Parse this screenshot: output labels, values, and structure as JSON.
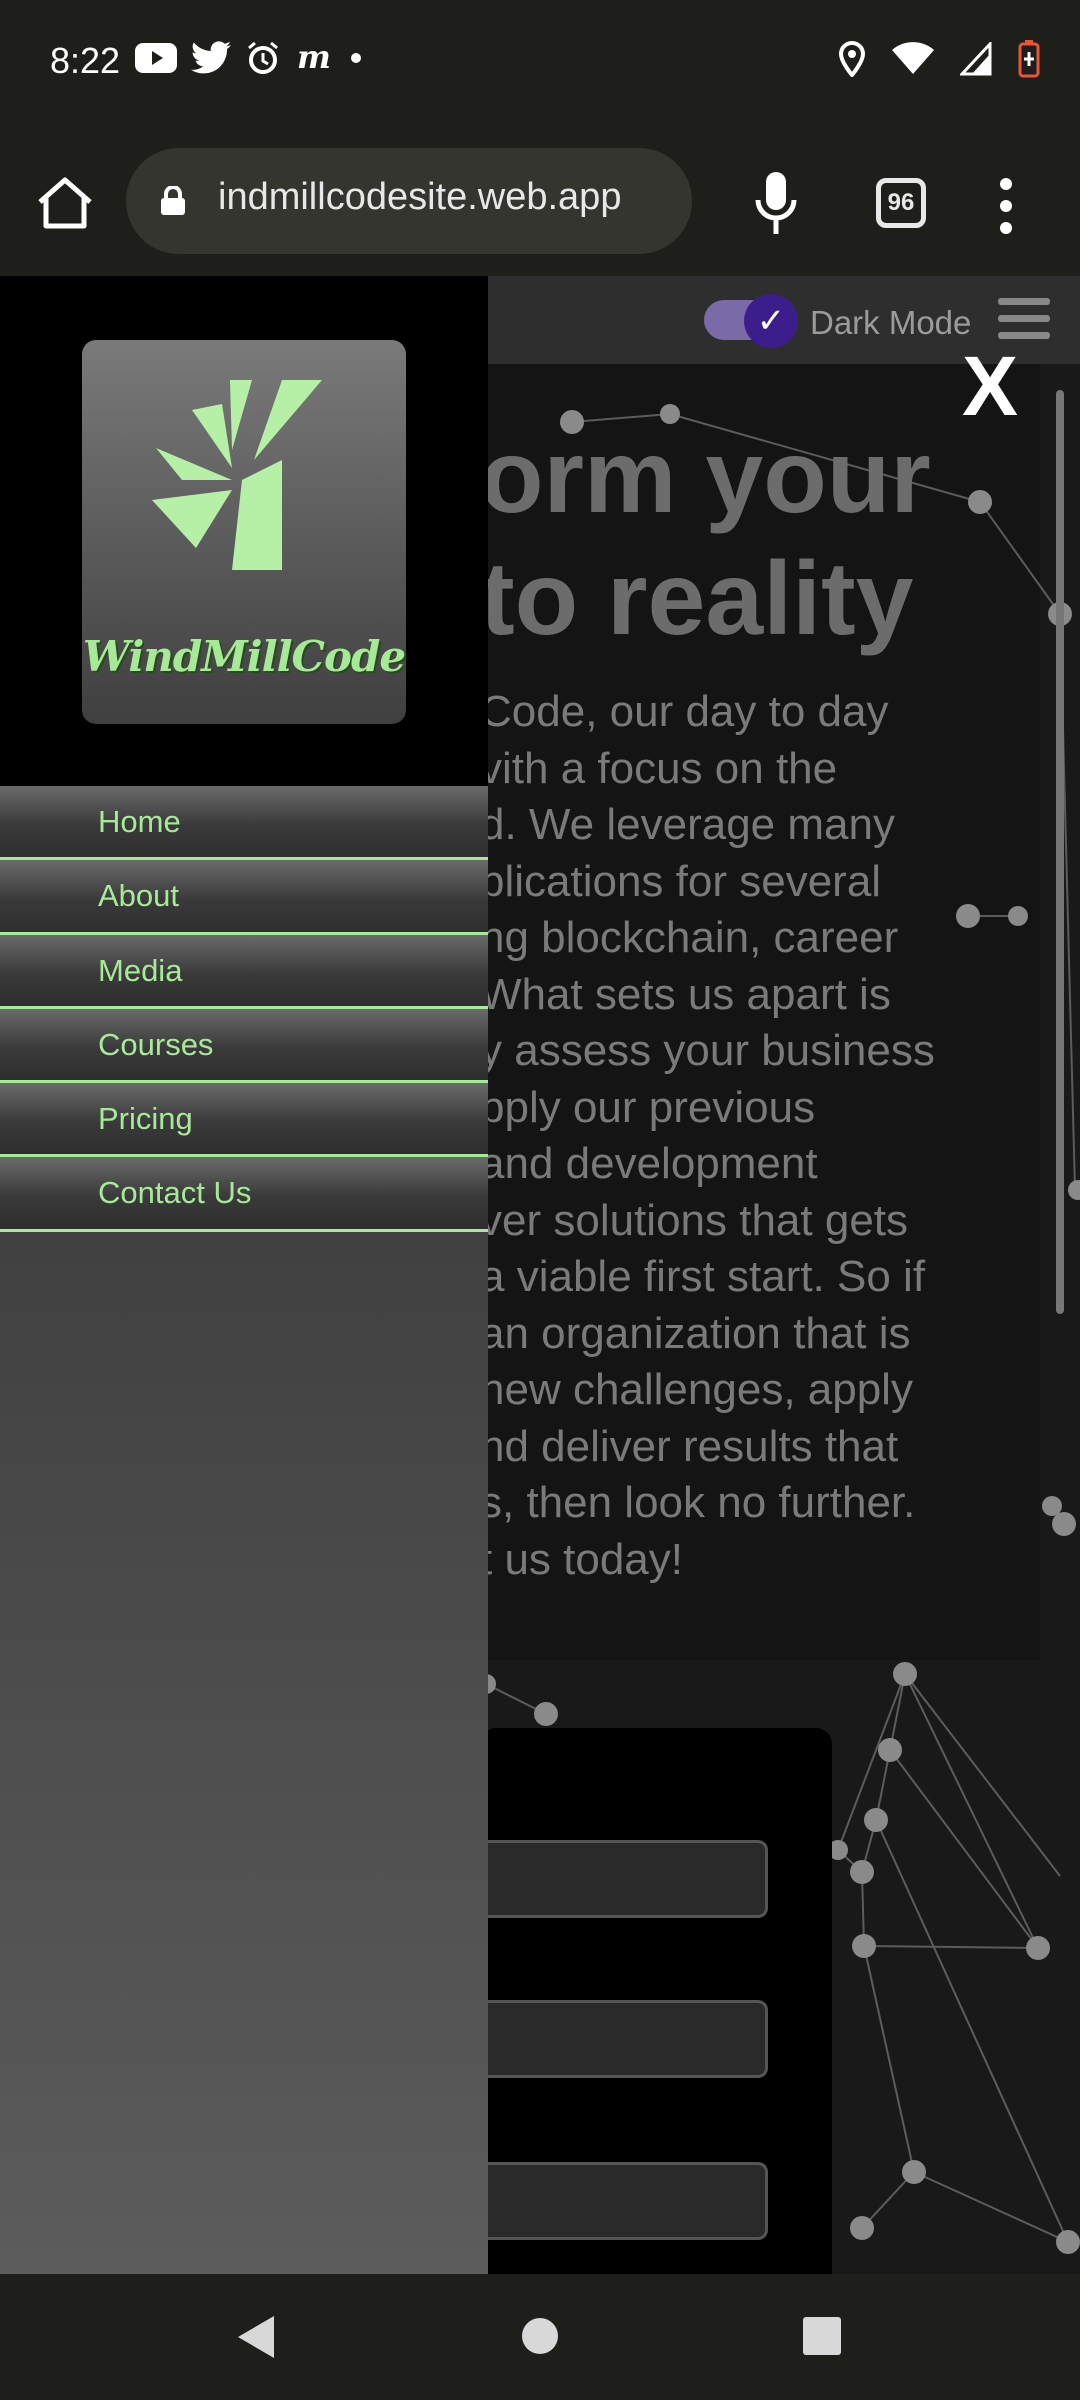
{
  "status_bar": {
    "time": "8:22",
    "notification_icons": [
      "youtube-icon",
      "twitter-icon",
      "alarm-icon",
      "app-m-icon",
      "dot-icon"
    ],
    "status_icons": [
      "location-icon",
      "wifi-icon",
      "signal-icon",
      "battery-icon"
    ]
  },
  "browser": {
    "url": "indmillcodesite.web.app",
    "tab_count": "96"
  },
  "page": {
    "dark_mode_label": "Dark Mode",
    "close_label": "X",
    "headline": "orm your\nto reality",
    "body": "Code, our day to day\nvith a focus on the\nd. We leverage many\nplications for several\nng blockchain, career\nWhat sets us apart is\ny assess your business\npply our previous\nand development\nver solutions that gets\na viable first start. So if\nan organization that is\nnew challenges, apply\nnd deliver results that\ns, then look no further.\nt us today!"
  },
  "drawer": {
    "logo_text": "WindMillCode",
    "menu": [
      {
        "label": "Home"
      },
      {
        "label": "About"
      },
      {
        "label": "Media"
      },
      {
        "label": "Courses"
      },
      {
        "label": "Pricing"
      },
      {
        "label": "Contact Us"
      }
    ]
  },
  "colors": {
    "accent": "#a6e996",
    "toggle": "#3b1e8c"
  }
}
